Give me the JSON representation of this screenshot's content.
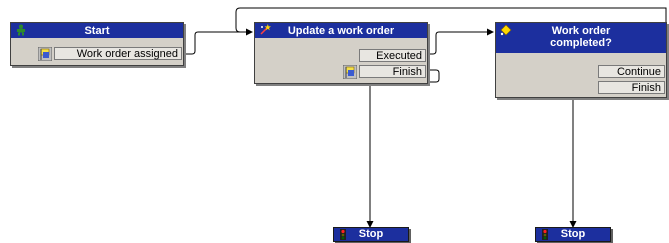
{
  "nodes": {
    "start": {
      "title": "Start",
      "branches": [
        "Work order assigned"
      ]
    },
    "update": {
      "title": "Update a work order",
      "branches": [
        "Executed",
        "Finish"
      ]
    },
    "decision": {
      "title_line1": "Work order",
      "title_line2": "completed?",
      "branches": [
        "Continue",
        "Finish"
      ]
    },
    "stop_left": {
      "title": "Stop"
    },
    "stop_right": {
      "title": "Stop"
    }
  },
  "colors": {
    "header": "#1c2f9e",
    "body": "#d4d0c8",
    "wire": "#000000"
  }
}
